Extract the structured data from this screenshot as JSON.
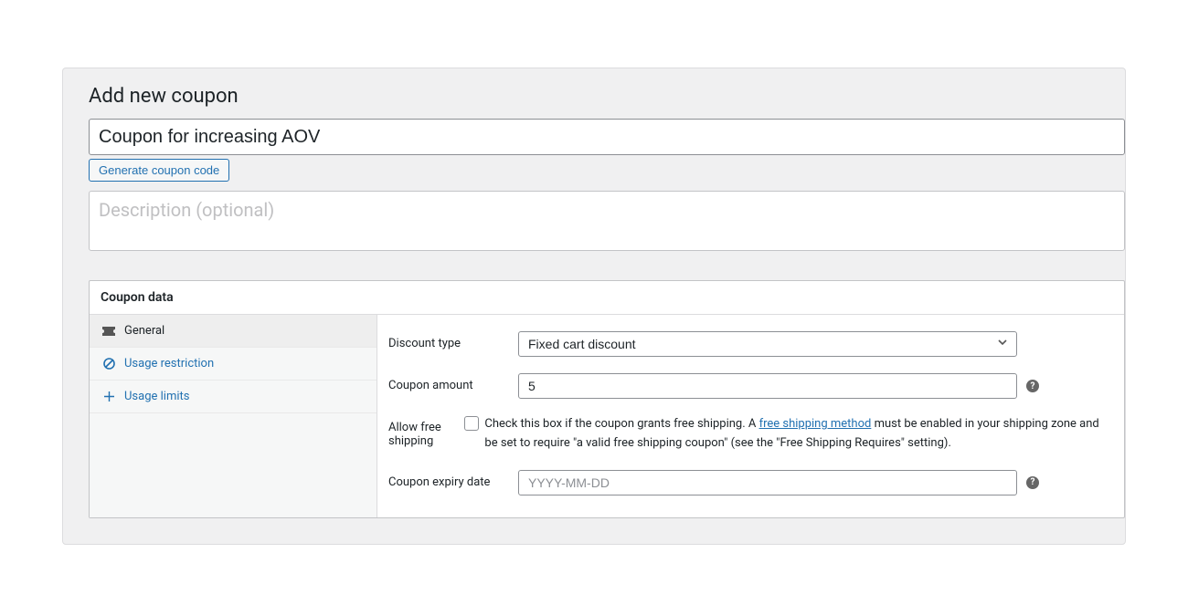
{
  "page": {
    "title": "Add new coupon",
    "coupon_title_value": "Coupon for increasing AOV",
    "generate_btn": "Generate coupon code",
    "description_placeholder": "Description (optional)"
  },
  "metabox": {
    "title": "Coupon data",
    "tabs": [
      {
        "icon": "ticket",
        "label": "General"
      },
      {
        "icon": "ban",
        "label": "Usage restriction"
      },
      {
        "icon": "adjust",
        "label": "Usage limits"
      }
    ]
  },
  "general": {
    "discount_type_label": "Discount type",
    "discount_type_value": "Fixed cart discount",
    "coupon_amount_label": "Coupon amount",
    "coupon_amount_value": "5",
    "allow_free_shipping_label": "Allow free shipping",
    "free_shipping_text_pre": "Check this box if the coupon grants free shipping. A ",
    "free_shipping_link": "free shipping method",
    "free_shipping_text_post": " must be enabled in your shipping zone and be set to require \"a valid free shipping coupon\" (see the \"Free Shipping Requires\" setting).",
    "expiry_label": "Coupon expiry date",
    "expiry_placeholder": "YYYY-MM-DD",
    "help_glyph": "?"
  }
}
